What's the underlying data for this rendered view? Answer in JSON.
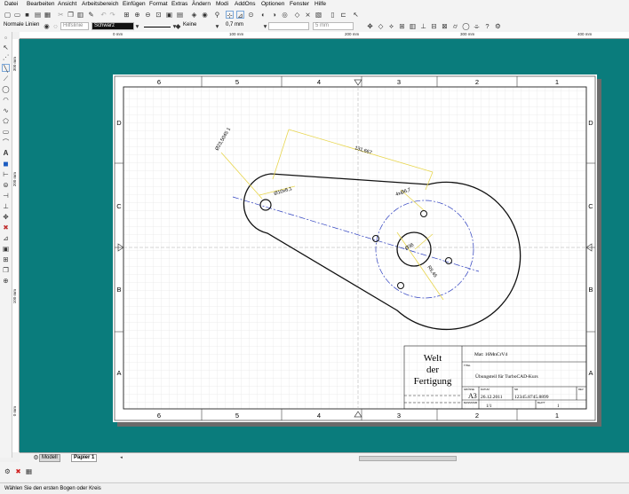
{
  "menu": [
    "Datei",
    "Bearbeiten",
    "Ansicht",
    "Arbeitsbereich",
    "Einfügen",
    "Format",
    "Extras",
    "Ändern",
    "Modi",
    "AddOns",
    "Optionen",
    "Fenster",
    "Hilfe"
  ],
  "toolbar2": {
    "line_style": "Normale Linien",
    "pen_color": "Schwarz",
    "fill": "Keine",
    "line_width": "0,7 mm",
    "unit_width": "5 mm",
    "hidden_label": "Hilfslinie"
  },
  "ruler_h": [
    "0 mm",
    "100 mm",
    "200 mm",
    "300 mm",
    "400 mm"
  ],
  "ruler_v": [
    "300 mm",
    "200 mm",
    "100 mm",
    "0 mm"
  ],
  "drawing": {
    "zone_cols": [
      "6",
      "5",
      "4",
      "3",
      "2",
      "1"
    ],
    "zone_rows": [
      "D",
      "C",
      "B",
      "A"
    ],
    "dims": {
      "overall": "131,667",
      "angle": "Ø23,5045 1",
      "small_bore": "Ø10x6,1",
      "holes": "4xØ6,7",
      "center_bore": "Ø36",
      "pitch": "R5,45"
    }
  },
  "titleblock": {
    "company": [
      "Welt",
      "der",
      "Fertigung"
    ],
    "material": "Mat: 16MnCrV4",
    "title_label": "TITEL",
    "title": "Übungsteil für TurboCAD-Kurs",
    "size_label": "GRÖSSE",
    "size": "A3",
    "date_label": "DATUM",
    "date": "26.12.2011",
    "nr_label": "NR",
    "nr": "12345.8745.8899",
    "rev_label": "REV",
    "scale_label": "MASSSTAB",
    "scale": "1/1",
    "sheet_label": "BLATT",
    "sheet": "1"
  },
  "tabs": {
    "model": "Modell",
    "paper": "Papier 1"
  },
  "status": "Wählen Sie den ersten Bogen oder Kreis",
  "colors": {
    "canvas": "#0a7c7c",
    "dimension": "#f2e36a",
    "centerline": "#2d3fbf"
  }
}
